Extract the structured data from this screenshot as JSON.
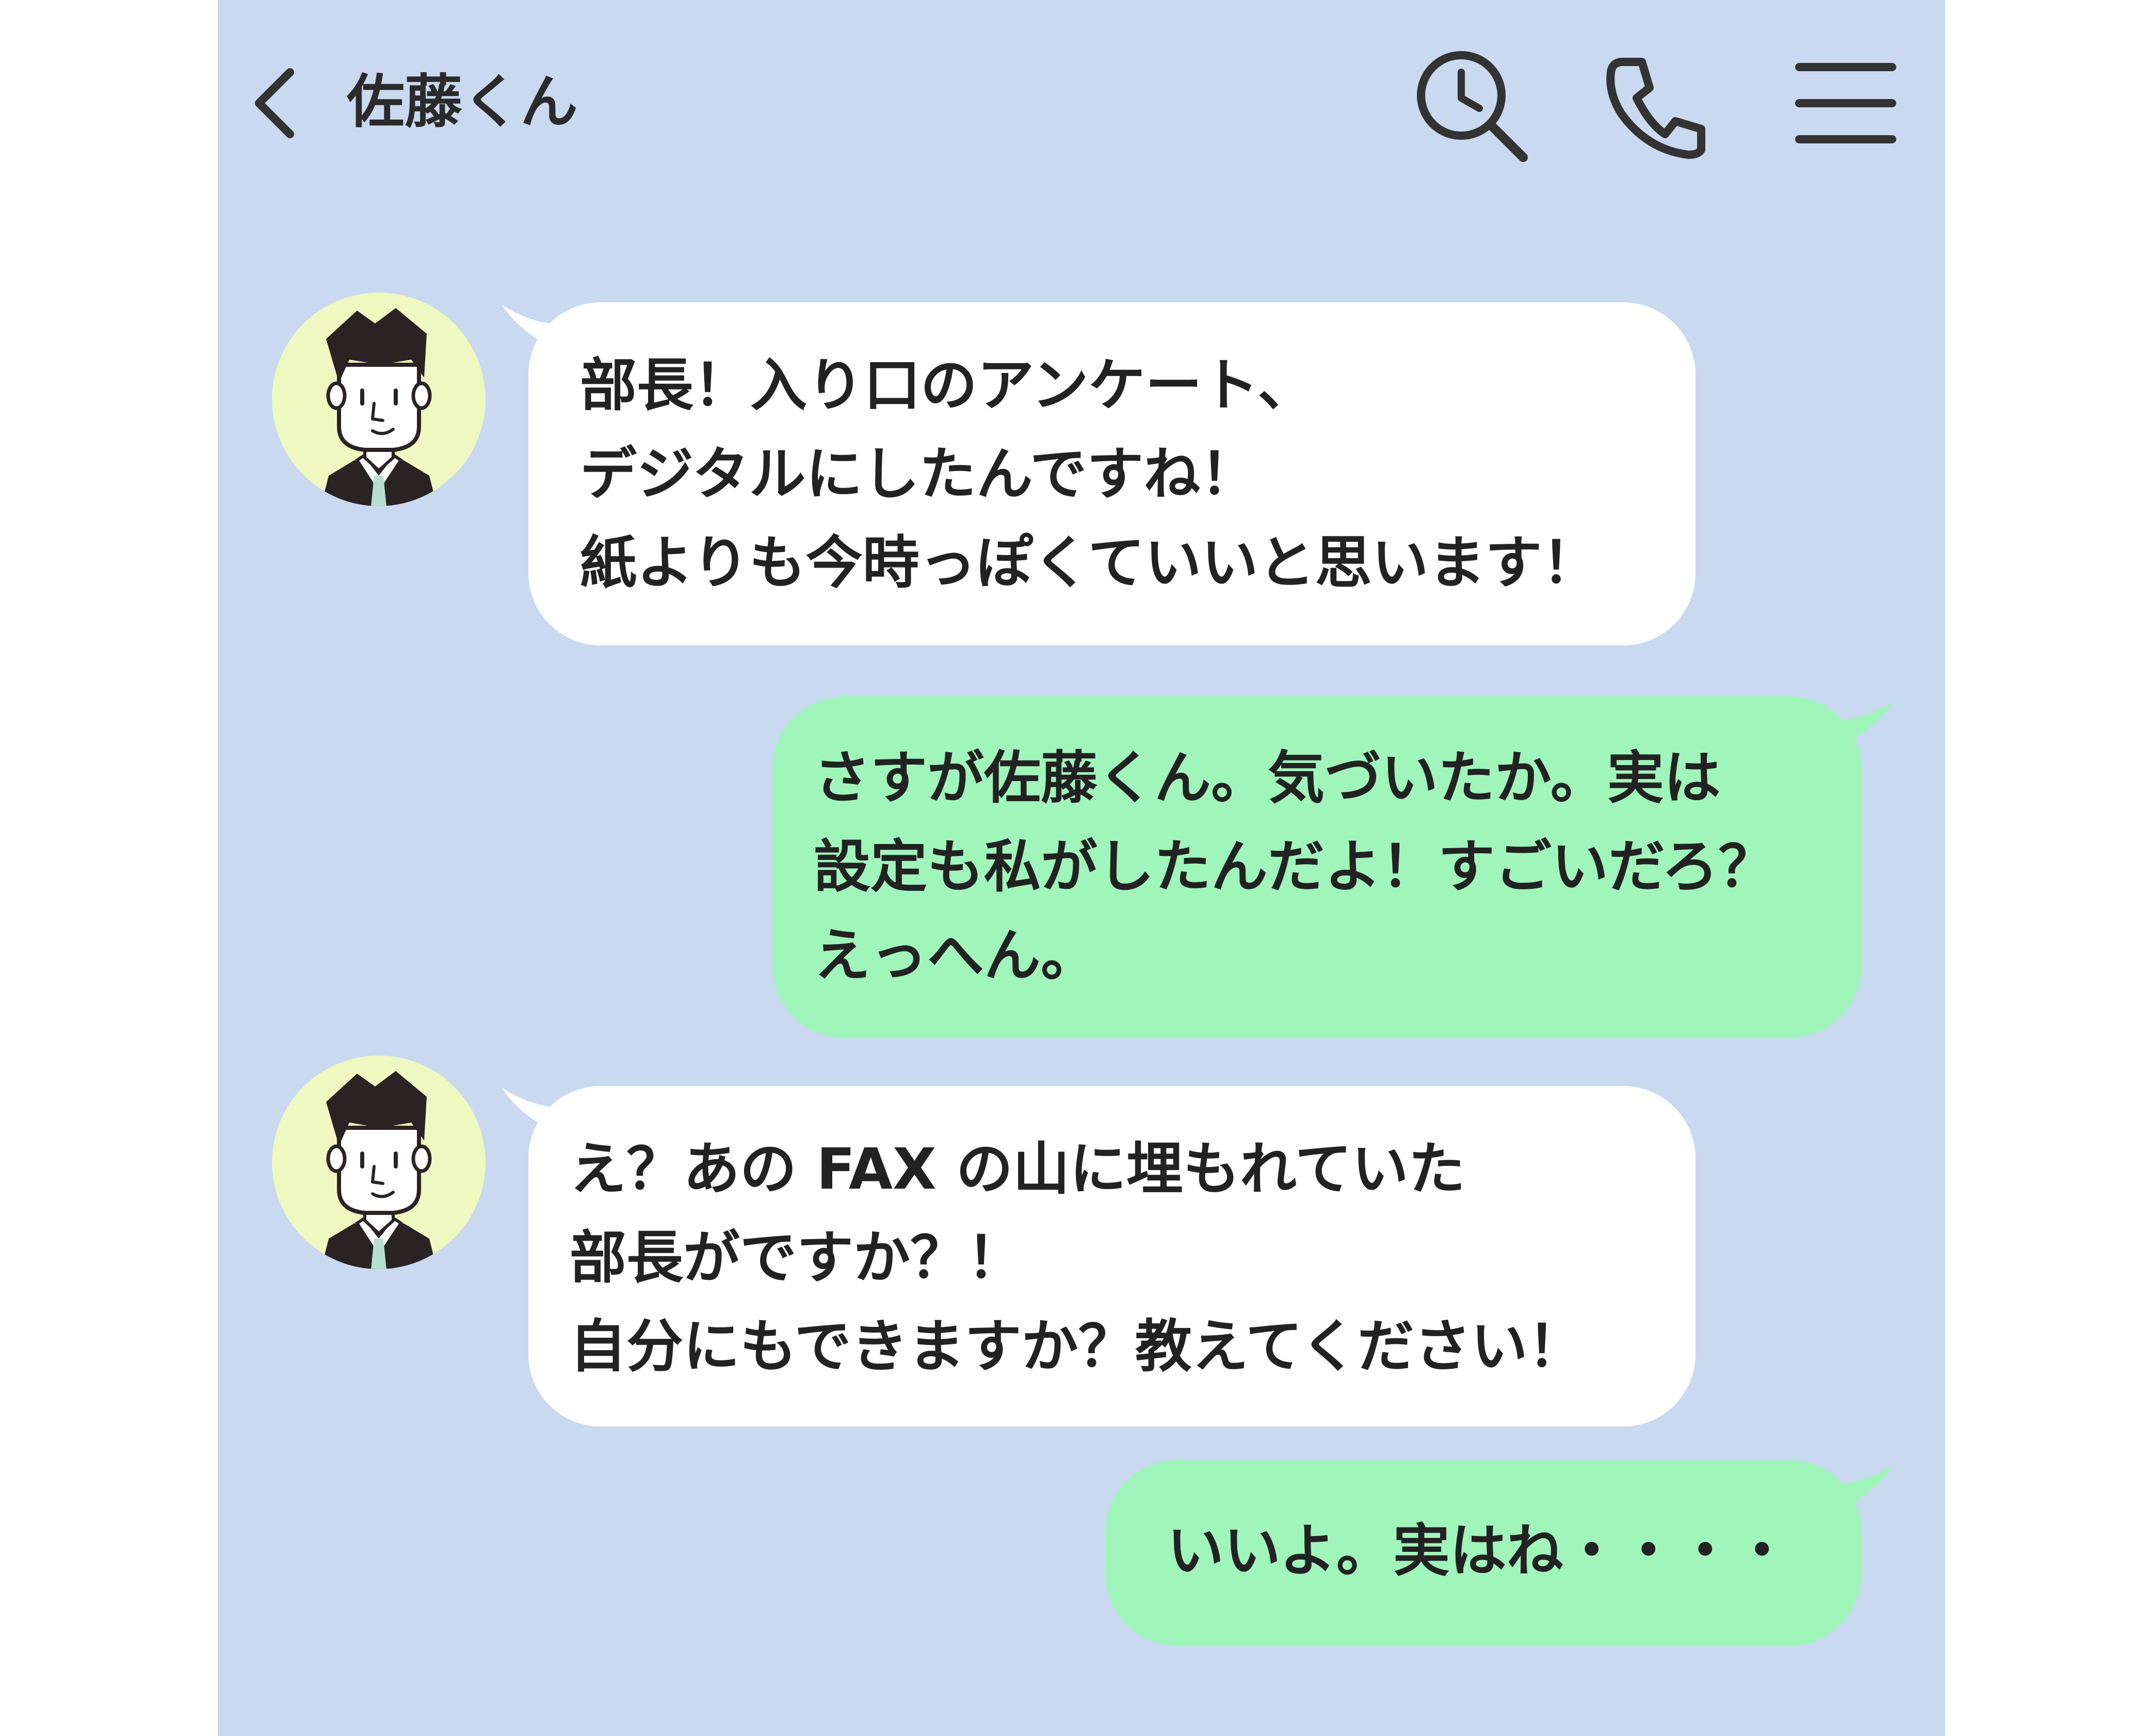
{
  "header": {
    "back_icon": "chevron-left-icon",
    "contact_name": "佐藤くん",
    "search_icon": "search-history-icon",
    "call_icon": "phone-icon",
    "menu_icon": "hamburger-menu-icon"
  },
  "colors": {
    "background": "#c9d9f0",
    "incoming_bubble": "#ffffff",
    "outgoing_bubble": "#a0f5bb",
    "text": "#222222",
    "icon": "#333333",
    "avatar_bg": "#eef8c0"
  },
  "messages": [
    {
      "sender": "incoming",
      "lines": [
        "部長！入り口のアンケート、",
        "デジタルにしたんですね！",
        "紙よりも今時っぽくていいと思います！"
      ]
    },
    {
      "sender": "outgoing",
      "lines": [
        "さすが佐藤くん。気づいたか。実は",
        "設定も私がしたんだよ！すごいだろ？",
        "えっへん。"
      ]
    },
    {
      "sender": "incoming",
      "lines": [
        "え？あの FAX の山に埋もれていた",
        "部長がですか？！",
        "自分にもできますか？教えてください！"
      ]
    },
    {
      "sender": "outgoing",
      "lines": [
        "いいよ。実はね・・・・"
      ]
    }
  ]
}
